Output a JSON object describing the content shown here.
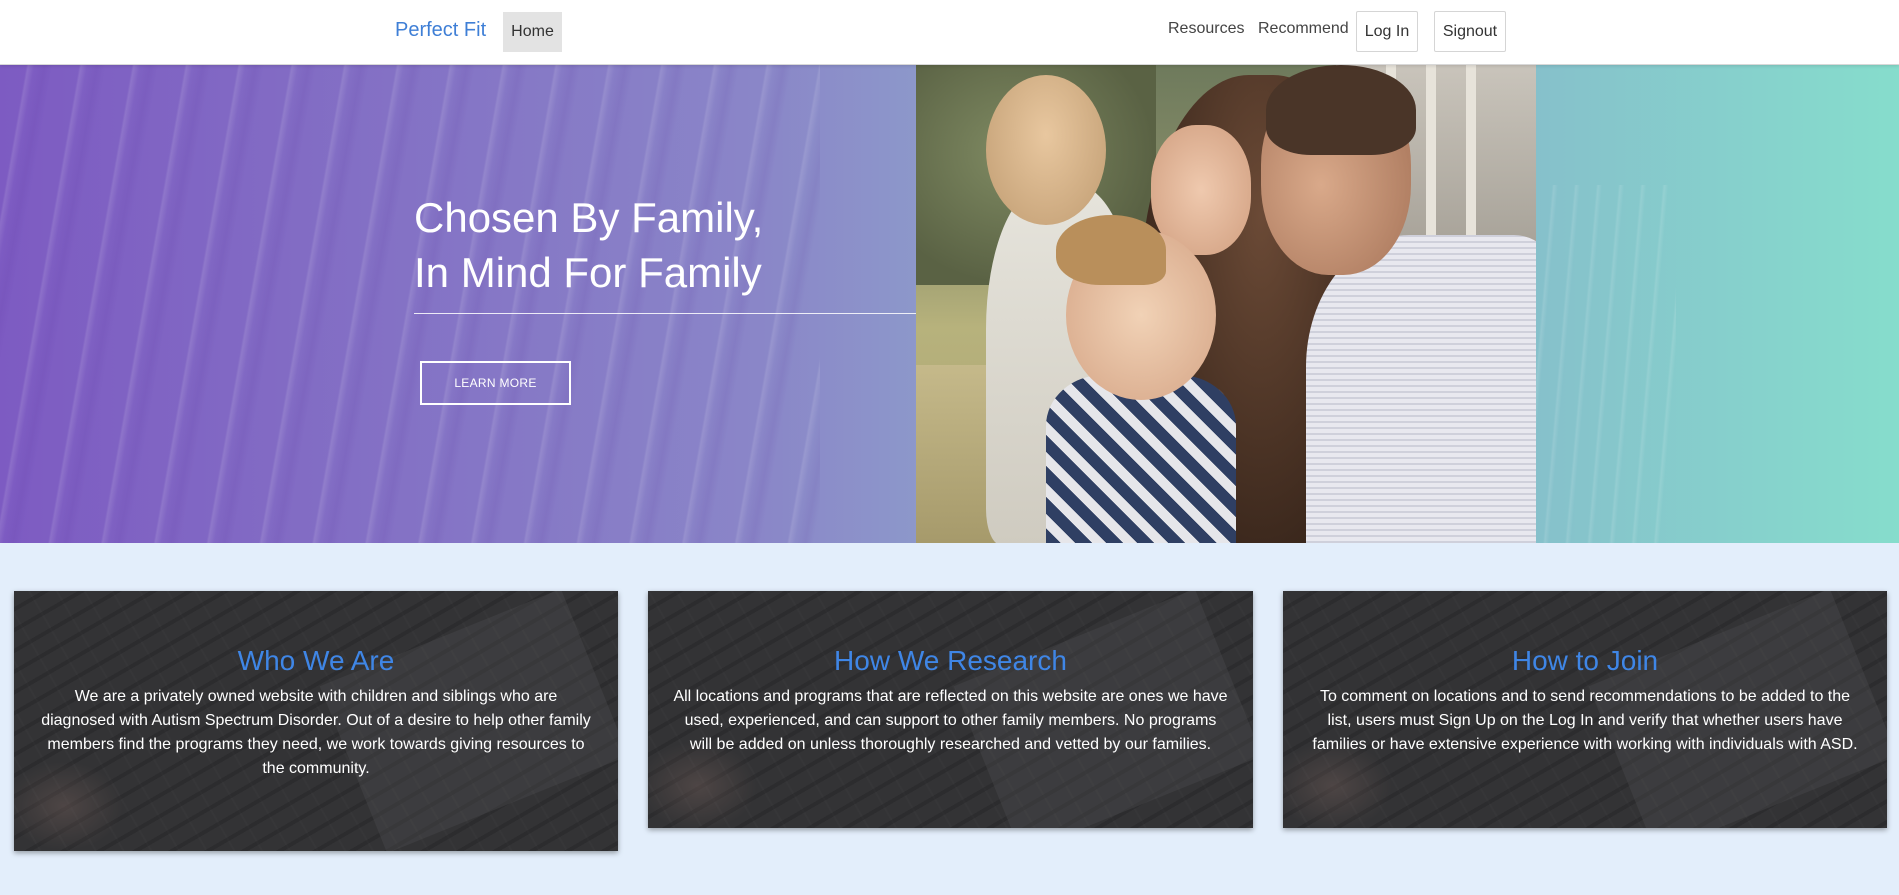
{
  "navbar": {
    "brand": "Perfect Fit",
    "home": "Home",
    "resources": "Resources",
    "recommend": "Recommend",
    "login": "Log In",
    "signout": "Signout"
  },
  "hero": {
    "title_line1": "Chosen By Family,",
    "title_line2": "In Mind For Family",
    "button": "LEARN MORE"
  },
  "features": [
    {
      "title": "Who We Are",
      "text": "We are a privately owned website with children and siblings who are diagnosed with Autism Spectrum Disorder. Out of a desire to help other family members find the programs they need, we work towards giving resources to the community."
    },
    {
      "title": "How We Research",
      "text": "All locations and programs that are reflected on this website are ones we have used, experienced, and can support to other family members. No programs will be added on unless thoroughly researched and vetted by our families."
    },
    {
      "title": "How to Join",
      "text": "To comment on locations and to send recommendations to be added to the list, users must Sign Up on the Log In and verify that whether users have families or have extensive experience with working with individuals with ASD."
    }
  ],
  "colors": {
    "brand_blue": "#3f7fd6",
    "card_title_blue": "#3f86e6",
    "features_bg": "#e3eefb"
  }
}
